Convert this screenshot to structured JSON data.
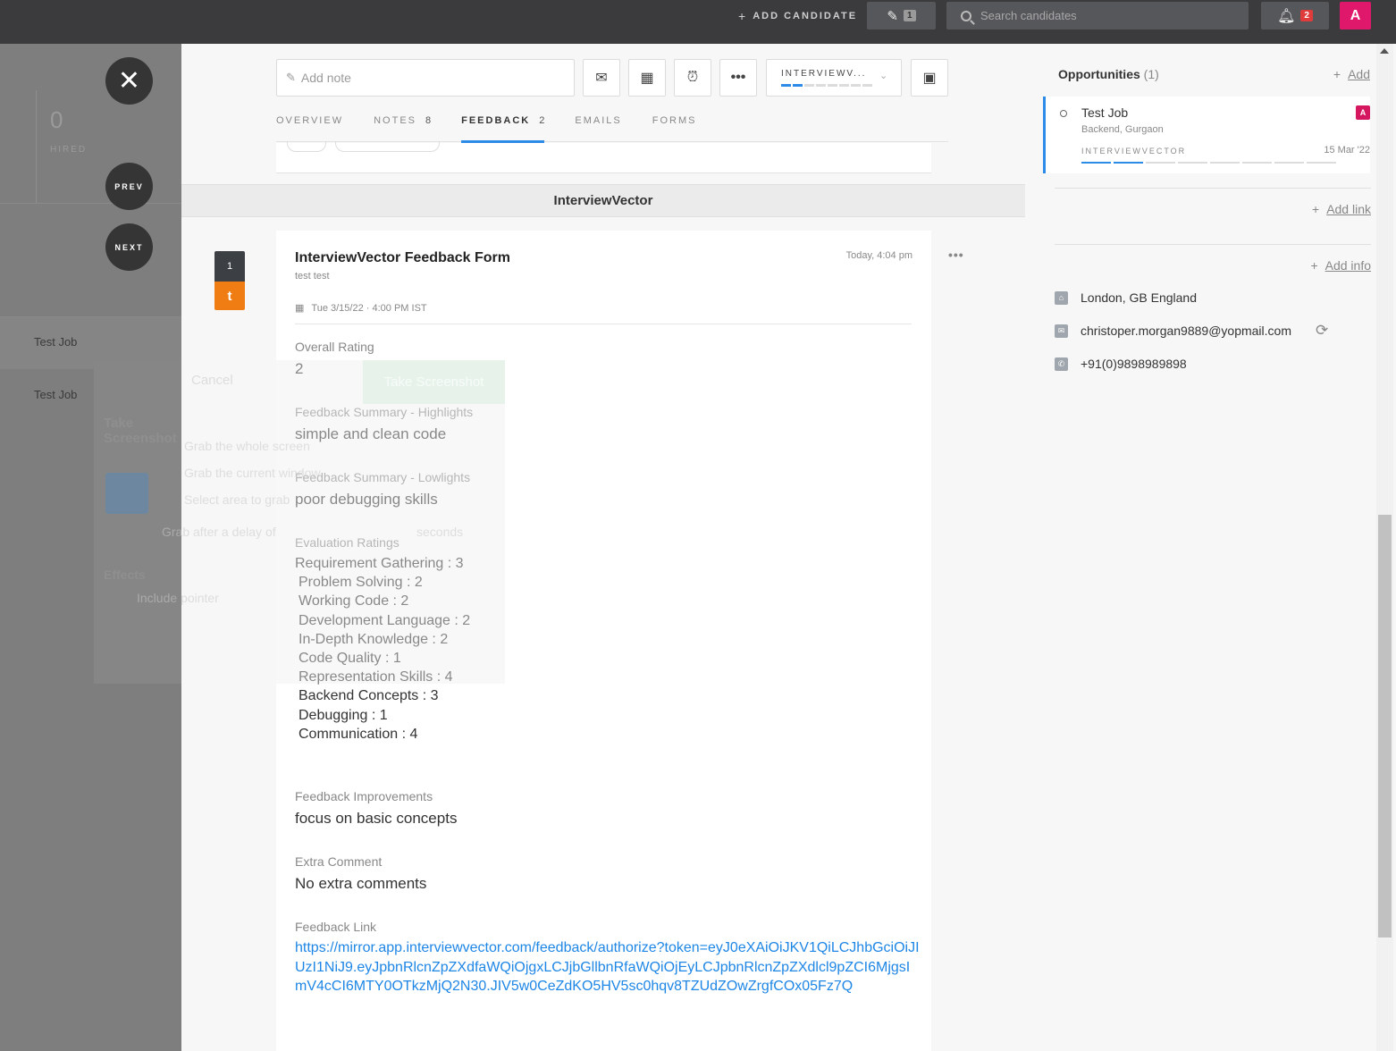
{
  "topbar": {
    "add_candidate": "ADD CANDIDATE",
    "edit_count": "1",
    "search_placeholder": "Search candidates",
    "notif_count": "2",
    "avatar_letter": "A"
  },
  "left": {
    "hired_count": "0",
    "hired_label": "HIRED",
    "prev": "PREV",
    "next": "NEXT",
    "jobs": [
      "Test Job",
      "Test Job"
    ],
    "screenshot_title": "Take Screenshot",
    "effects_label": "Effects"
  },
  "toolbar": {
    "note_placeholder": "Add note",
    "stage": "INTERVIEWV...",
    "stage_progress_filled": 2,
    "stage_progress_total": 8
  },
  "tabs": [
    {
      "label": "OVERVIEW",
      "count": ""
    },
    {
      "label": "NOTES",
      "count": "8"
    },
    {
      "label": "FEEDBACK",
      "count": "2",
      "active": true
    },
    {
      "label": "EMAILS",
      "count": ""
    },
    {
      "label": "FORMS",
      "count": ""
    }
  ],
  "group": {
    "title": "InterviewVector"
  },
  "feedback": {
    "number": "1",
    "initial": "t",
    "title": "InterviewVector Feedback Form",
    "author": "test test",
    "time": "Today, 4:04 pm",
    "date": "Tue 3/15/22 · 4:00 PM IST",
    "overall_label": "Overall Rating",
    "overall_value": "2",
    "highlights_label": "Feedback Summary - Highlights",
    "highlights_value": "simple and clean code",
    "lowlights_label": "Feedback Summary - Lowlights",
    "lowlights_value": "poor debugging skills",
    "eval_label": "Evaluation Ratings",
    "evals": [
      "Requirement Gathering : 3",
      "Problem Solving : 2",
      "Working Code : 2",
      "Development Language : 2",
      "In-Depth Knowledge : 2",
      "Code Quality : 1",
      "Representation Skills : 4",
      "Backend Concepts : 3",
      "Debugging : 1",
      "Communication : 4"
    ],
    "improvements_label": "Feedback Improvements",
    "improvements_value": "focus on basic concepts",
    "extra_label": "Extra Comment",
    "extra_value": "No extra comments",
    "link_label": "Feedback Link",
    "link_value": "https://mirror.app.interviewvector.com/feedback/authorize?token=eyJ0eXAiOiJKV1QiLCJhbGciOiJIUzI1NiJ9.eyJpbnRlcnZpZXdfaWQiOjgxLCJjbGllbnRfaWQiOjEyLCJpbnRlcnZpZXdlcl9pZCI6MjgsImV4cCI6MTY0OTkzMjQ2N30.JIV5w0CeZdKO5HV5sc0hqv8TZUdZOwZrgfCOx05Fz7Q"
  },
  "screenshot_overlay": {
    "cancel": "Cancel",
    "take": "Take Screenshot",
    "opt1": "Grab the whole screen",
    "opt2": "Grab the current window",
    "opt3": "Select area to grab",
    "delay": "Grab after a delay of",
    "seconds": "seconds",
    "pointer": "Include pointer"
  },
  "opportunities": {
    "title": "Opportunities",
    "count": "(1)",
    "add": "Add",
    "job_title": "Test Job",
    "job_location": "Backend, Gurgaon",
    "job_stage": "INTERVIEWVECTOR",
    "job_date": "15 Mar '22",
    "owner_badge": "A",
    "stage_progress_filled": 2,
    "stage_progress_total": 8
  },
  "contact": {
    "add_link": "Add link",
    "add_info": "Add info",
    "location": "London, GB England",
    "email": "christoper.morgan9889@yopmail.com",
    "phone": "+91(0)9898989898"
  },
  "colors": {
    "accent": "#2b8be6",
    "brand_pink": "#e0186c",
    "tag_orange": "#f07d13"
  }
}
